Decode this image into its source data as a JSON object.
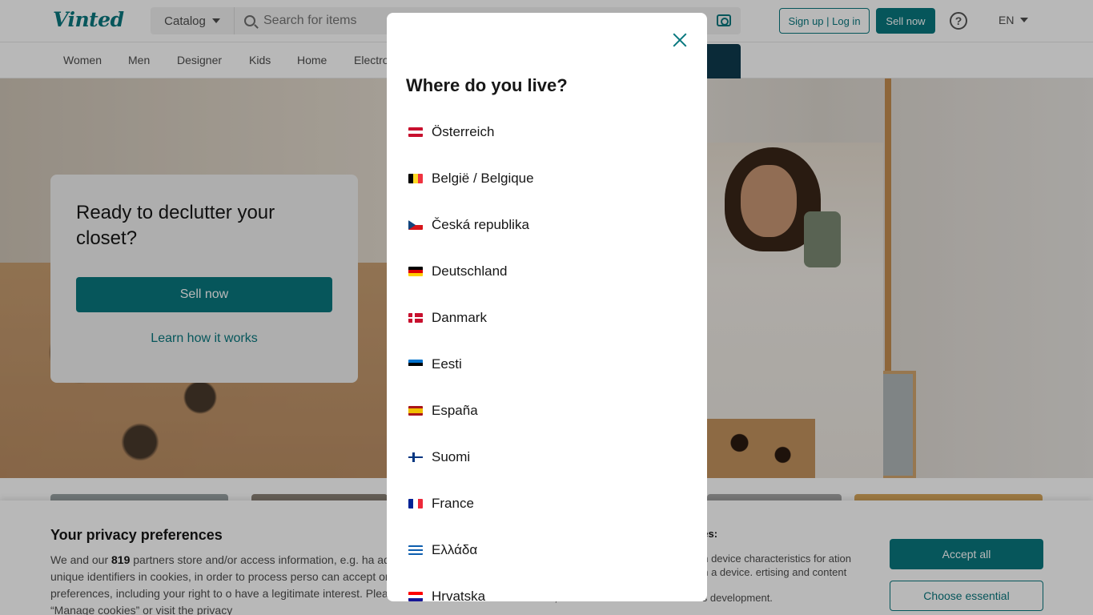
{
  "header": {
    "logo": "Vinted",
    "catalog_label": "Catalog",
    "search_placeholder": "Search for items",
    "signup_label": "Sign up | Log in",
    "sell_label": "Sell now",
    "help_symbol": "?",
    "language": "EN"
  },
  "categories": [
    "Women",
    "Men",
    "Designer",
    "Kids",
    "Home",
    "Electro"
  ],
  "hero": {
    "title": "Ready to declutter your closet?",
    "sell_button": "Sell now",
    "learn_link": "Learn how it works"
  },
  "cookie": {
    "title": "Your privacy preferences",
    "text_start": "We and our ",
    "partner_count": "819",
    "text_rest": " partners store and/or access information, e.g. ha addresses, unique identifiers in cookies, in order to process perso can accept or manage your preferences, including your right to o have a legitimate interest. Please click on “Manage cookies” or visit the privacy",
    "right_title": "ses:",
    "right_text": "an device characteristics for ation on a device. ertising and content",
    "foot_text": "measurement, audience research and services development.",
    "accept_label": "Accept all",
    "essential_label": "Choose essential"
  },
  "modal": {
    "title": "Where do you live?",
    "countries": [
      {
        "name": "Österreich",
        "flag": [
          "#c8102e",
          "#ffffff",
          "#c8102e"
        ],
        "dir": "h"
      },
      {
        "name": "België / Belgique",
        "flag": [
          "#000000",
          "#fdda24",
          "#ef3340"
        ],
        "dir": "v"
      },
      {
        "name": "Česká republika",
        "flag": [
          "#ffffff",
          "#d7141a"
        ],
        "dir": "h",
        "wedge": "#11457e"
      },
      {
        "name": "Deutschland",
        "flag": [
          "#000000",
          "#dd0000",
          "#ffce00"
        ],
        "dir": "h"
      },
      {
        "name": "Danmark",
        "flag": [
          "#c8102e"
        ],
        "dir": "h",
        "cross": "#ffffff"
      },
      {
        "name": "Eesti",
        "flag": [
          "#0072ce",
          "#000000",
          "#ffffff"
        ],
        "dir": "h"
      },
      {
        "name": "España",
        "flag": [
          "#aa151b",
          "#f1bf00",
          "#f1bf00",
          "#aa151b"
        ],
        "dir": "h"
      },
      {
        "name": "Suomi",
        "flag": [
          "#ffffff"
        ],
        "dir": "h",
        "cross": "#003580"
      },
      {
        "name": "France",
        "flag": [
          "#002395",
          "#ffffff",
          "#ed2939"
        ],
        "dir": "v"
      },
      {
        "name": "Ελλάδα",
        "flag": [
          "#0d5eaf",
          "#ffffff",
          "#0d5eaf",
          "#ffffff",
          "#0d5eaf"
        ],
        "dir": "h"
      },
      {
        "name": "Hrvatska",
        "flag": [
          "#ff0000",
          "#ffffff",
          "#171796"
        ],
        "dir": "h"
      }
    ]
  }
}
